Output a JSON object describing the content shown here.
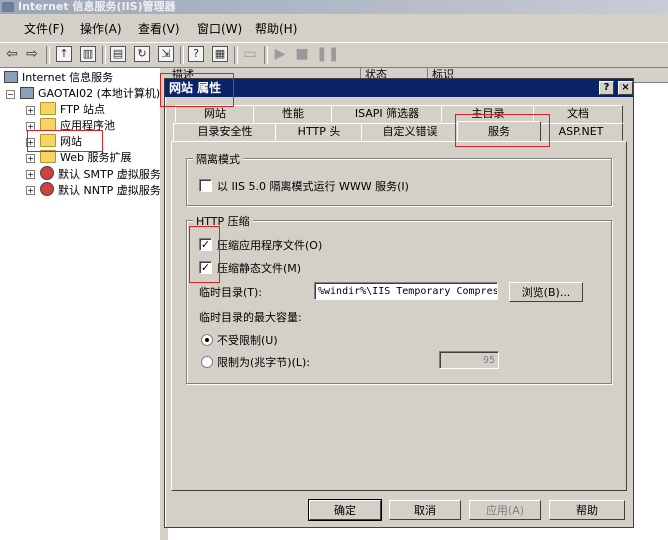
{
  "window": {
    "title": "Internet 信息服务(IIS)管理器"
  },
  "menu": [
    "文件(F)",
    "操作(A)",
    "查看(V)",
    "窗口(W)",
    "帮助(H)"
  ],
  "toolbar_icons": [
    "back-arrow-icon",
    "forward-arrow-icon",
    "up-folder-icon",
    "show-tree-icon",
    "properties-icon",
    "refresh-icon",
    "export-icon",
    "help-icon",
    "mmc-icon",
    "computer-icon",
    "play-icon",
    "stop-icon",
    "pause-icon"
  ],
  "tree": {
    "root": "Internet 信息服务",
    "server": "GAOTAI02 (本地计算机)",
    "items": [
      "FTP 站点",
      "应用程序池",
      "网站",
      "Web 服务扩展",
      "默认 SMTP 虚拟服务器",
      "默认 NNTP 虚拟服务器"
    ]
  },
  "list_header": [
    "描述",
    "状态",
    "标识"
  ],
  "dialog": {
    "title": "网站 属性",
    "help_btn": "?",
    "close_btn": "×",
    "tabs_row1": [
      "网站",
      "性能",
      "ISAPI 筛选器",
      "主目录",
      "文档"
    ],
    "tabs_row2": [
      "目录安全性",
      "HTTP 头",
      "自定义错误",
      "服务",
      "ASP.NET"
    ],
    "isolation": {
      "legend": "隔离模式",
      "checkbox_label": "以 IIS 5.0 隔离模式运行 WWW 服务(I)",
      "checked": false
    },
    "http_compression": {
      "legend": "HTTP 压缩",
      "compress_apps_label": "压缩应用程序文件(O)",
      "compress_apps_checked": true,
      "compress_static_label": "压缩静态文件(M)",
      "compress_static_checked": true,
      "temp_dir_label": "临时目录(T):",
      "temp_dir_value": "%windir%\\IIS Temporary Compressed Files",
      "browse_btn": "浏览(B)...",
      "max_size_label": "临时目录的最大容量:",
      "unlimited_label": "不受限制(U)",
      "limit_label": "限制为(兆字节)(L):",
      "limit_value": "95"
    },
    "buttons": {
      "ok": "确定",
      "cancel": "取消",
      "apply": "应用(A)",
      "help": "帮助"
    }
  },
  "colors": {
    "highlight": "#e02020",
    "dialog_title": "#0a246a",
    "face": "#d4d0c8"
  }
}
